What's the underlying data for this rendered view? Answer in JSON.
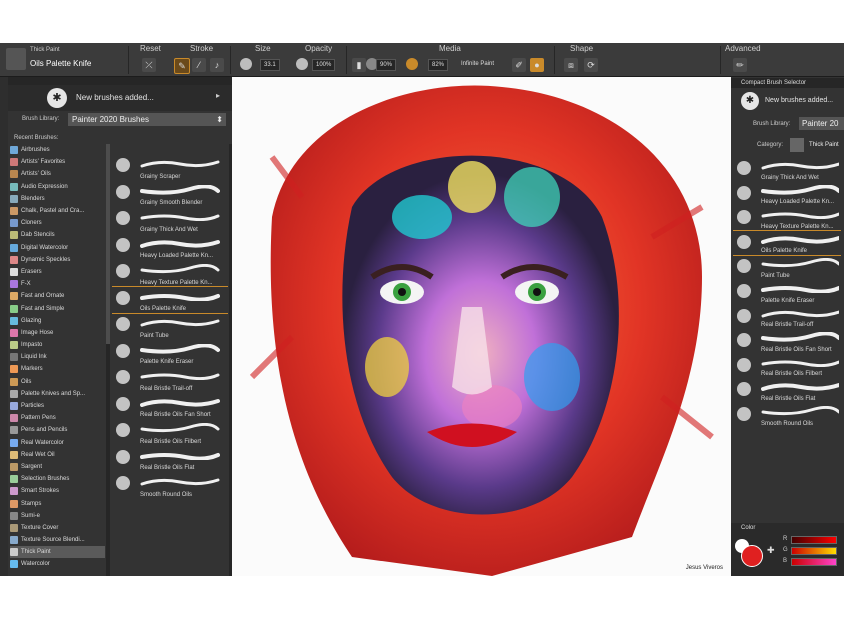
{
  "propbar": {
    "brush_category": "Thick Paint",
    "brush_name": "Oils Palette Knife",
    "labels": [
      "Reset",
      "Stroke",
      "Size",
      "Opacity",
      "Media",
      "Shape",
      "Advanced"
    ],
    "size_value": "33.1",
    "opacity_value": "100%",
    "media_value1": "90%",
    "media_value2": "82%",
    "infinite_label": "Infinite Paint"
  },
  "left_panel": {
    "new_brushes": "New brushes added...",
    "library_label": "Brush Library:",
    "library_value": "Painter 2020 Brushes",
    "recent_label": "Recent Brushes:",
    "categories": [
      {
        "label": "Airbrushes",
        "color": "#6fa8d8"
      },
      {
        "label": "Artists' Favorites",
        "color": "#c77"
      },
      {
        "label": "Artists' Oils",
        "color": "#b8864f"
      },
      {
        "label": "Audio Expression",
        "color": "#7bb"
      },
      {
        "label": "Blenders",
        "color": "#8ab"
      },
      {
        "label": "Chalk, Pastel and Cra...",
        "color": "#c96"
      },
      {
        "label": "Cloners",
        "color": "#79c"
      },
      {
        "label": "Dab Stencils",
        "color": "#bb7"
      },
      {
        "label": "Digital Watercolor",
        "color": "#6ad"
      },
      {
        "label": "Dynamic Speckles",
        "color": "#d88"
      },
      {
        "label": "Erasers",
        "color": "#ddd"
      },
      {
        "label": "F-X",
        "color": "#a7d"
      },
      {
        "label": "Fast and Ornate",
        "color": "#da6"
      },
      {
        "label": "Fast and Simple",
        "color": "#8c8"
      },
      {
        "label": "Glazing",
        "color": "#6bd"
      },
      {
        "label": "Image Hose",
        "color": "#d7a"
      },
      {
        "label": "Impasto",
        "color": "#bc8"
      },
      {
        "label": "Liquid Ink",
        "color": "#777"
      },
      {
        "label": "Markers",
        "color": "#e95"
      },
      {
        "label": "Oils",
        "color": "#c95"
      },
      {
        "label": "Palette Knives and Sp...",
        "color": "#aaa"
      },
      {
        "label": "Particles",
        "color": "#9ad"
      },
      {
        "label": "Pattern Pens",
        "color": "#c8a"
      },
      {
        "label": "Pens and Pencils",
        "color": "#999"
      },
      {
        "label": "Real Watercolor",
        "color": "#7ae"
      },
      {
        "label": "Real Wet Oil",
        "color": "#db7"
      },
      {
        "label": "Sargent",
        "color": "#b96"
      },
      {
        "label": "Selection Brushes",
        "color": "#9c9"
      },
      {
        "label": "Smart Strokes",
        "color": "#c9c"
      },
      {
        "label": "Stamps",
        "color": "#d96"
      },
      {
        "label": "Sumi-e",
        "color": "#888"
      },
      {
        "label": "Texture Cover",
        "color": "#a97"
      },
      {
        "label": "Texture Source Blendi...",
        "color": "#8ac"
      },
      {
        "label": "Thick Paint",
        "color": "#ccc"
      },
      {
        "label": "Watercolor",
        "color": "#6be"
      }
    ],
    "selected_category_index": 33,
    "brushes": [
      "Grainy Scraper",
      "Grainy Smooth Blender",
      "Grainy Thick And Wet",
      "Heavy Loaded Palette Kn...",
      "Heavy Texture Palette Kn...",
      "Oils Palette Knife",
      "Paint Tube",
      "Palette Knife Eraser",
      "Real Bristle Trail-off",
      "Real Bristle Oils Fan Short",
      "Real Bristle Oils Filbert",
      "Real Bristle Oils Flat",
      "Smooth Round Oils"
    ],
    "selected_brush_index": 5
  },
  "canvas": {
    "credit": "Jesus Viveros"
  },
  "right_panel": {
    "title": "Compact Brush Selector",
    "new_brushes": "New brushes added...",
    "library_label": "Brush Library:",
    "library_value": "Painter 20",
    "category_label": "Category:",
    "category_value": "Thick Paint",
    "brushes": [
      "Grainy Thick And Wet",
      "Heavy Loaded Palette Kn...",
      "Heavy Texture Palette Kn...",
      "Oils Palette Knife",
      "Paint Tube",
      "Palette Knife Eraser",
      "Real Bristle Trail-off",
      "Real Bristle Oils Fan Short",
      "Real Bristle Oils Filbert",
      "Real Bristle Oils Flat",
      "Smooth Round Oils"
    ],
    "selected_brush_index": 3,
    "color_title": "Color",
    "slider_labels": [
      "R",
      "G",
      "B"
    ],
    "main_color": "#e02020"
  }
}
